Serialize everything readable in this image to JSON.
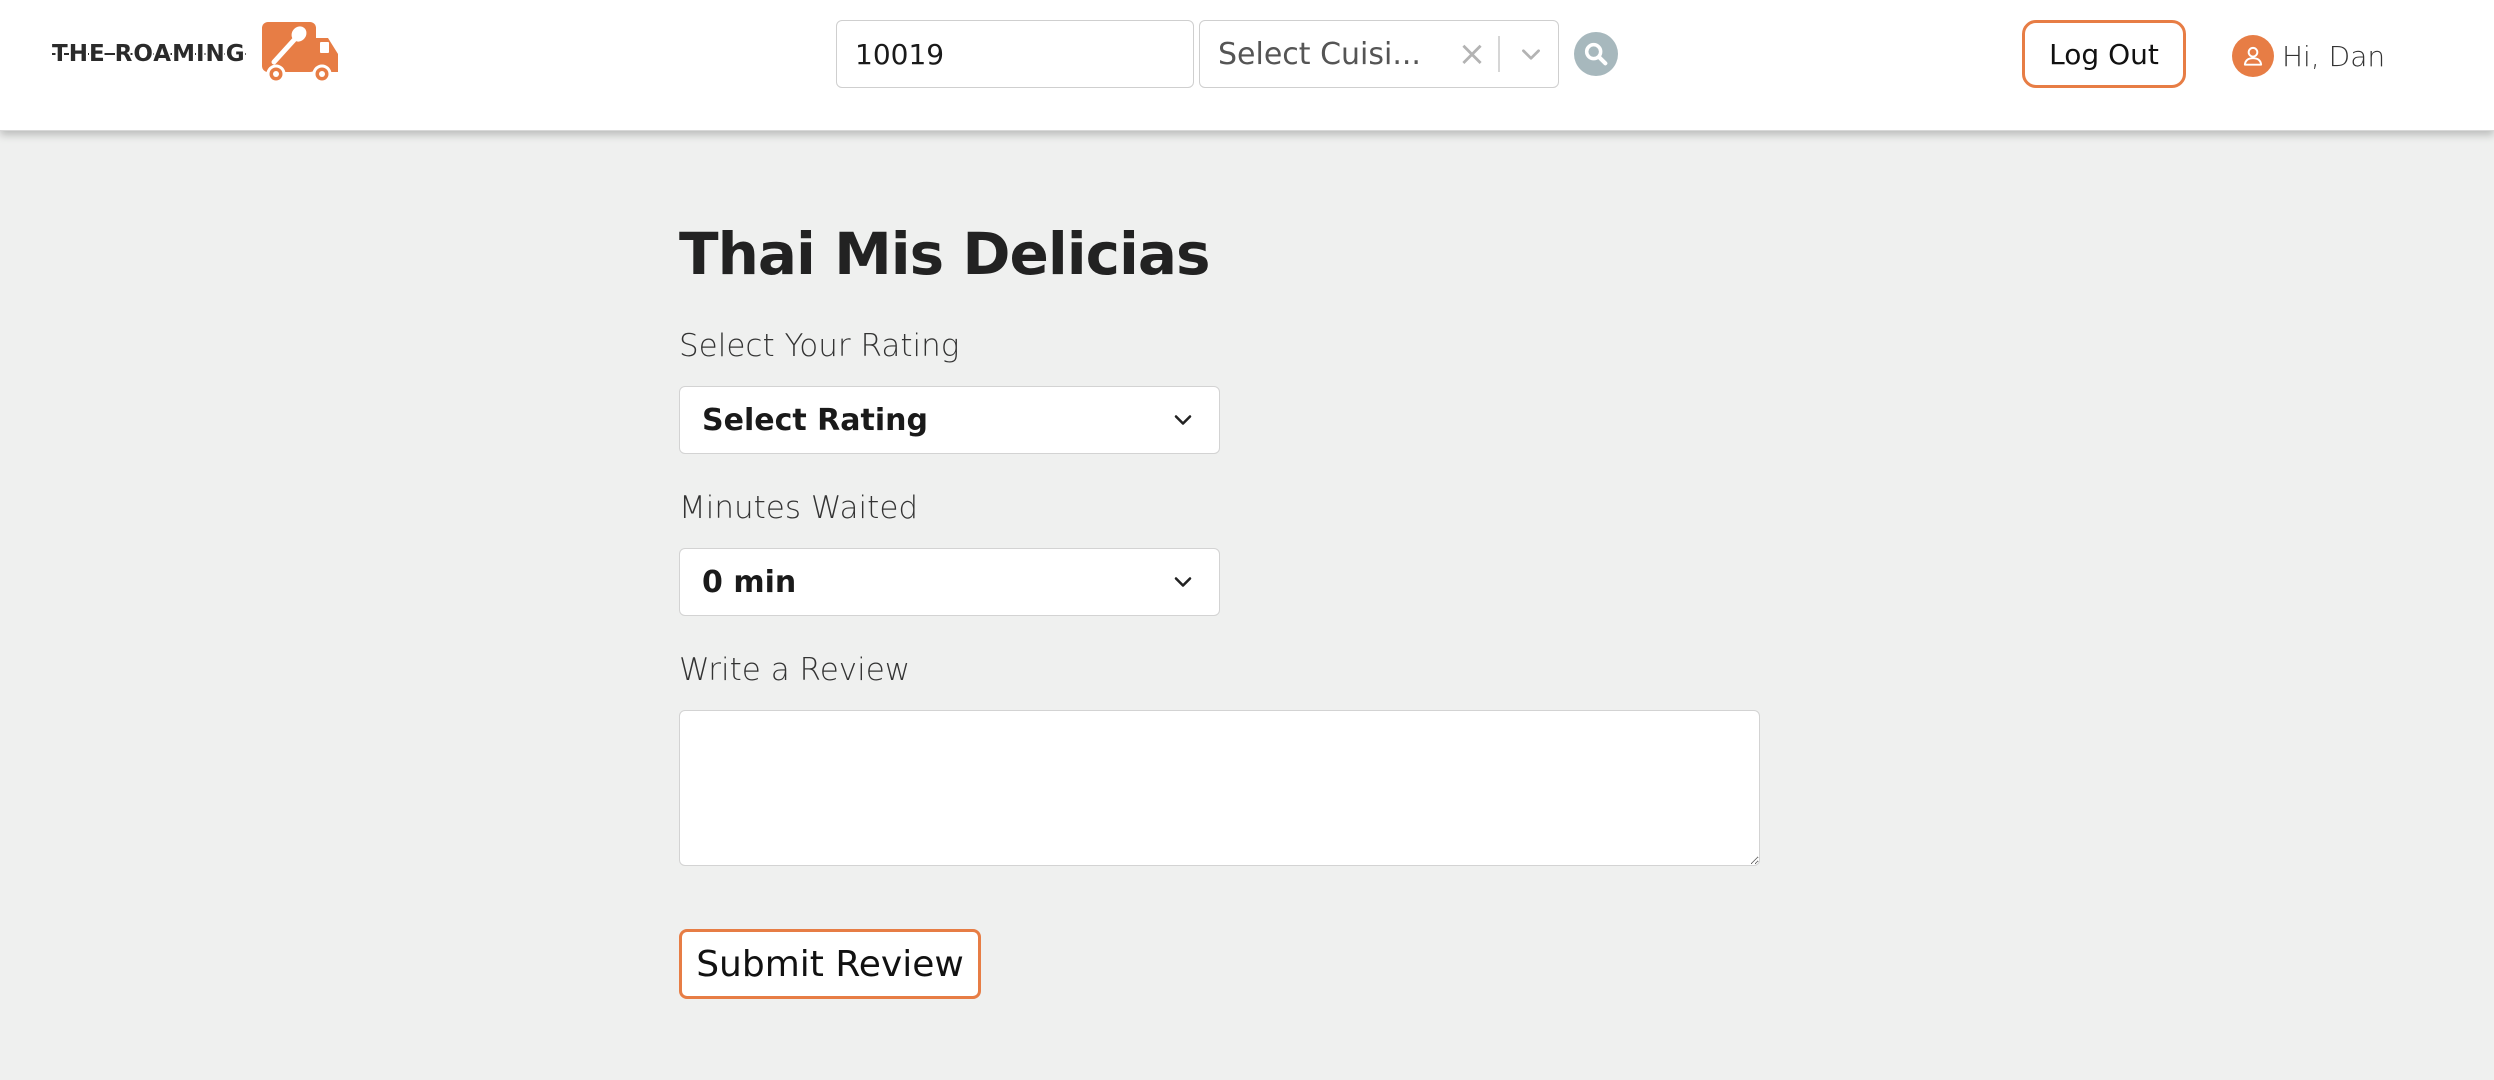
{
  "header": {
    "brand_text": "THE ROAMING",
    "zip_value": "10019",
    "cuisine_value": "Select Cuisi...",
    "clear_glyph": "×",
    "logout_label": "Log Out",
    "greeting": "Hi, Dan",
    "icons": {
      "logo": "food-truck-icon",
      "clear": "close-icon",
      "chevron": "chevron-down-icon",
      "search": "search-icon",
      "avatar": "user-icon"
    }
  },
  "form": {
    "title": "Thai Mis Delicias",
    "rating_label": "Select Your Rating",
    "rating_value": "Select Rating",
    "minutes_label": "Minutes Waited",
    "minutes_value": "0 min",
    "review_label": "Write a Review",
    "review_value": "",
    "submit_label": "Submit Review"
  },
  "colors": {
    "accent": "#e77d45",
    "background": "#eff0ef",
    "header_bg": "#ffffff",
    "search_button": "#a7b8bd"
  }
}
